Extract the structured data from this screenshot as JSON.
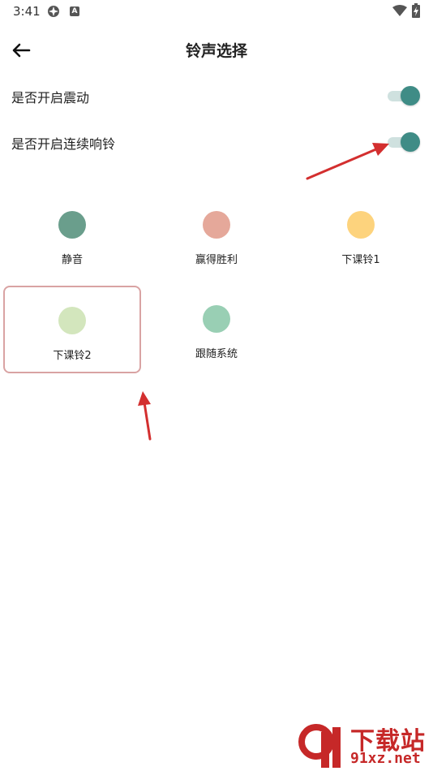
{
  "status_bar": {
    "time": "3:41",
    "notif_b": "A"
  },
  "header": {
    "title": "铃声选择"
  },
  "settings": [
    {
      "label": "是否开启震动",
      "on": true
    },
    {
      "label": "是否开启连续响铃",
      "on": true
    }
  ],
  "ringtones": [
    {
      "name": "静音",
      "color": "#6a9e8c",
      "selected": false
    },
    {
      "name": "赢得胜利",
      "color": "#e5a89a",
      "selected": false
    },
    {
      "name": "下课铃1",
      "color": "#fdd37d",
      "selected": false
    },
    {
      "name": "下课铃2",
      "color": "#d3e6bd",
      "selected": true
    },
    {
      "name": "跟随系统",
      "color": "#99cfb4",
      "selected": false
    }
  ],
  "colors": {
    "accent": "#3f8c86",
    "track": "#cfe1df",
    "annotation_red": "#d32f2f"
  },
  "watermark": {
    "text_main": "下载站",
    "text_domain": "91xz.net"
  }
}
